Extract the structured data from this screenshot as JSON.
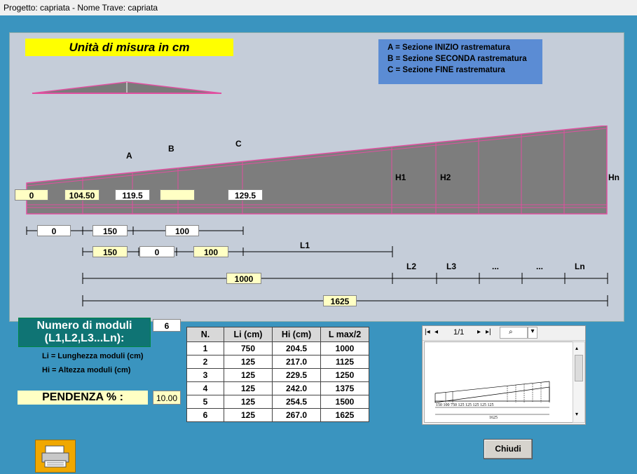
{
  "window": {
    "title": "Progetto: capriata - Nome Trave: capriata"
  },
  "units_title": "Unità di misura in cm",
  "legend": [
    "A  = Sezione INIZIO rastrematura",
    "B  = Sezione SECONDA rastrematura",
    "C  = Sezione FINE rastrematura"
  ],
  "section_labels": {
    "a": "A",
    "b": "B",
    "c": "C",
    "h1": "H1",
    "h2": "H2",
    "hn": "Hn"
  },
  "heights": {
    "h0": "0",
    "h_a": "104.50",
    "h_b": "119.5",
    "h_c": "",
    "h_d": "129.5"
  },
  "dims_row1": {
    "d1": "0",
    "d2": "150",
    "d3": "100"
  },
  "dims_row2": {
    "d1": "150",
    "d2": "0",
    "d3": "100",
    "l1": "L1"
  },
  "dims_row3": {
    "total_l1": "1000",
    "l2": "L2",
    "l3": "L3",
    "dots1": "...",
    "dots2": "...",
    "ln": "Ln"
  },
  "dims_row4": {
    "total": "1625"
  },
  "moduli": {
    "label": "Numero di moduli (L1,L2,L3...Ln):",
    "value": "6"
  },
  "notes": {
    "li": "Li = Lunghezza moduli (cm)",
    "hi": "Hi = Altezza moduli (cm)"
  },
  "pendenza": {
    "label": "PENDENZA % :",
    "value": "10.00"
  },
  "table": {
    "headers": [
      "N.",
      "Li (cm)",
      "Hi (cm)",
      "L max/2"
    ],
    "rows": [
      [
        "1",
        "750",
        "204.5",
        "1000"
      ],
      [
        "2",
        "125",
        "217.0",
        "1125"
      ],
      [
        "3",
        "125",
        "229.5",
        "1250"
      ],
      [
        "4",
        "125",
        "242.0",
        "1375"
      ],
      [
        "5",
        "125",
        "254.5",
        "1500"
      ],
      [
        "6",
        "125",
        "267.0",
        "1625"
      ]
    ]
  },
  "preview": {
    "page": "1/1",
    "dims_bottom": "150 100      750        125 125 125 125 125",
    "total": "1625"
  },
  "buttons": {
    "close": "Chiudi"
  },
  "icons": {
    "print": "printer-icon"
  }
}
